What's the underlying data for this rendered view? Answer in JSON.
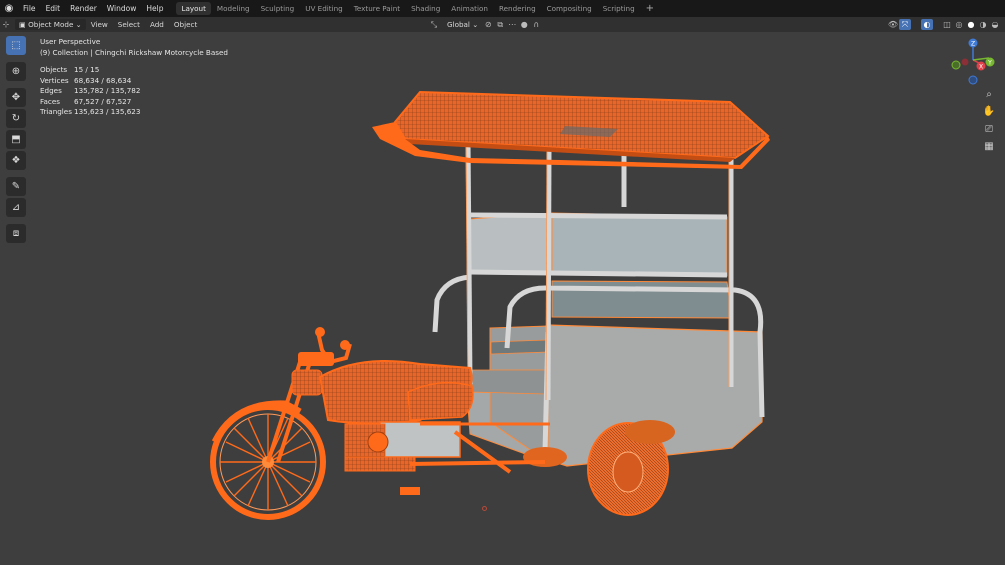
{
  "menubar": {
    "items": [
      "File",
      "Edit",
      "Render",
      "Window",
      "Help"
    ],
    "workspaces": [
      "Layout",
      "Modeling",
      "Sculpting",
      "UV Editing",
      "Texture Paint",
      "Shading",
      "Animation",
      "Rendering",
      "Compositing",
      "Scripting"
    ],
    "active_workspace": "Layout",
    "add_label": "+"
  },
  "viewport_header": {
    "mode": "Object Mode",
    "menus": [
      "View",
      "Select",
      "Add",
      "Object"
    ],
    "transform_orientation": "Global"
  },
  "overlay": {
    "perspective": "User Perspective",
    "collection": "(9) Collection | Chingchi Rickshaw Motorcycle Based",
    "stats": [
      {
        "label": "Objects",
        "value": "15 / 15"
      },
      {
        "label": "Vertices",
        "value": "68,634 / 68,634"
      },
      {
        "label": "Edges",
        "value": "135,782 / 135,782"
      },
      {
        "label": "Faces",
        "value": "67,527 / 67,527"
      },
      {
        "label": "Triangles",
        "value": "135,623 / 135,623"
      }
    ]
  },
  "gizmo": {
    "x_label": "X",
    "y_label": "Y",
    "z_label": "Z"
  },
  "colors": {
    "accent": "#4672b4",
    "selection": "#ff6a1a",
    "viewport_bg": "#3e3e3e"
  },
  "icons": [
    "select-box-icon",
    "cursor-icon",
    "move-icon",
    "rotate-icon",
    "scale-icon",
    "transform-icon",
    "annotate-icon",
    "measure-icon",
    "add-cube-icon",
    "zoom-icon",
    "hand-icon",
    "camera-icon",
    "grid-icon"
  ]
}
